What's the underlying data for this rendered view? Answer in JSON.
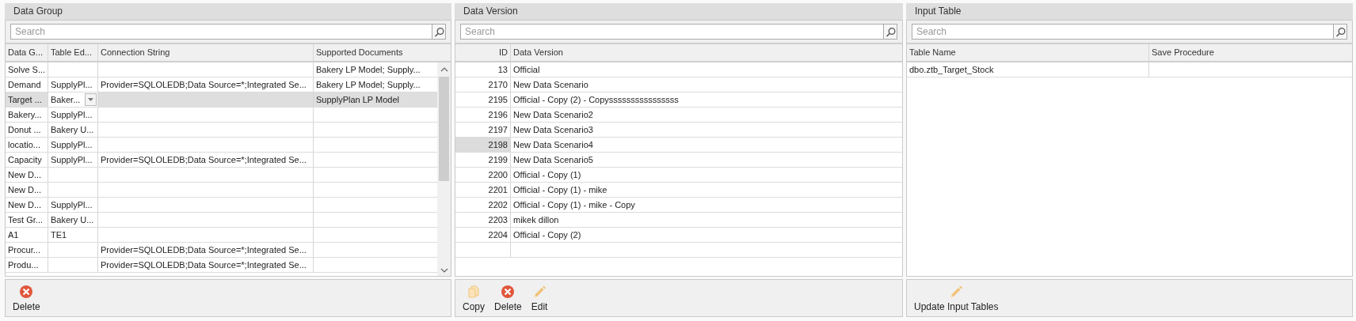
{
  "panels": [
    {
      "kind": "groups",
      "title": "Data Group",
      "search": {
        "placeholder": "Search"
      },
      "scrollbar": true,
      "table": {
        "columns": [
          "Data G...",
          "Table Ed...",
          "Connection String",
          "Supported Documents"
        ],
        "rows": [
          {
            "cells": [
              "Solve S...",
              "",
              "",
              "Bakery LP Model; Supply..."
            ],
            "selected": false,
            "dropdown": false
          },
          {
            "cells": [
              "Demand",
              "SupplyPl...",
              "Provider=SQLOLEDB;Data Source=*;Integrated Se...",
              "Bakery LP Model; Supply..."
            ],
            "selected": false,
            "dropdown": false
          },
          {
            "cells": [
              "Target ...",
              "Baker...",
              "",
              "SupplyPlan LP Model"
            ],
            "selected": true,
            "dropdown": true
          },
          {
            "cells": [
              "Bakery...",
              "SupplyPl...",
              "",
              ""
            ],
            "selected": false,
            "dropdown": false
          },
          {
            "cells": [
              "Donut ...",
              "Bakery U...",
              "",
              ""
            ],
            "selected": false,
            "dropdown": false
          },
          {
            "cells": [
              "locatio...",
              "SupplyPl...",
              "",
              ""
            ],
            "selected": false,
            "dropdown": false
          },
          {
            "cells": [
              "Capacity",
              "SupplyPl...",
              "Provider=SQLOLEDB;Data Source=*;Integrated Se...",
              ""
            ],
            "selected": false,
            "dropdown": false
          },
          {
            "cells": [
              "New D...",
              "",
              "",
              ""
            ],
            "selected": false,
            "dropdown": false
          },
          {
            "cells": [
              "New D...",
              "",
              "",
              ""
            ],
            "selected": false,
            "dropdown": false
          },
          {
            "cells": [
              "New D...",
              "SupplyPl...",
              "",
              ""
            ],
            "selected": false,
            "dropdown": false
          },
          {
            "cells": [
              "Test Gr...",
              "Bakery U...",
              "",
              ""
            ],
            "selected": false,
            "dropdown": false
          },
          {
            "cells": [
              "A1",
              "TE1",
              "",
              ""
            ],
            "selected": false,
            "dropdown": false
          },
          {
            "cells": [
              "Procur...",
              "",
              "Provider=SQLOLEDB;Data Source=*;Integrated Se...",
              ""
            ],
            "selected": false,
            "dropdown": false
          },
          {
            "cells": [
              "Produ...",
              "",
              "Provider=SQLOLEDB;Data Source=*;Integrated Se...",
              ""
            ],
            "selected": false,
            "dropdown": false
          }
        ]
      },
      "toolbar": [
        {
          "kind": "delete",
          "label": "Delete"
        }
      ]
    },
    {
      "kind": "versions",
      "title": "Data Version",
      "search": {
        "placeholder": "Search"
      },
      "scrollbar": false,
      "table": {
        "columns": [
          "ID",
          "Data Version"
        ],
        "rows": [
          {
            "cells": [
              "13",
              "Official"
            ],
            "selected": false
          },
          {
            "cells": [
              "2170",
              "New Data Scenario"
            ],
            "selected": false
          },
          {
            "cells": [
              "2195",
              "Official - Copy (2) - Copyssssssssssssssss"
            ],
            "selected": false
          },
          {
            "cells": [
              "2196",
              "New Data Scenario2"
            ],
            "selected": false
          },
          {
            "cells": [
              "2197",
              "New Data Scenario3"
            ],
            "selected": false
          },
          {
            "cells": [
              "2198",
              "New Data Scenario4"
            ],
            "selected": true
          },
          {
            "cells": [
              "2199",
              "New Data Scenario5"
            ],
            "selected": false
          },
          {
            "cells": [
              "2200",
              "Official - Copy (1)"
            ],
            "selected": false
          },
          {
            "cells": [
              "2201",
              "Official - Copy (1) - mike"
            ],
            "selected": false
          },
          {
            "cells": [
              "2202",
              "Official - Copy (1) - mike - Copy"
            ],
            "selected": false
          },
          {
            "cells": [
              "2203",
              "mikek dillon"
            ],
            "selected": false
          },
          {
            "cells": [
              "2204",
              "Official - Copy (2)"
            ],
            "selected": false
          }
        ]
      },
      "toolbar": [
        {
          "kind": "copy",
          "label": "Copy"
        },
        {
          "kind": "delete",
          "label": "Delete"
        },
        {
          "kind": "edit",
          "label": "Edit"
        }
      ]
    },
    {
      "kind": "inputs",
      "title": "Input Table",
      "search": {
        "placeholder": "Search"
      },
      "scrollbar": false,
      "table": {
        "columns": [
          "Table Name",
          "Save Procedure"
        ],
        "rows": [
          {
            "cells": [
              "dbo.ztb_Target_Stock",
              ""
            ],
            "selected": false
          }
        ]
      },
      "toolbar": [
        {
          "kind": "edit",
          "label": "Update Input Tables"
        }
      ]
    }
  ]
}
